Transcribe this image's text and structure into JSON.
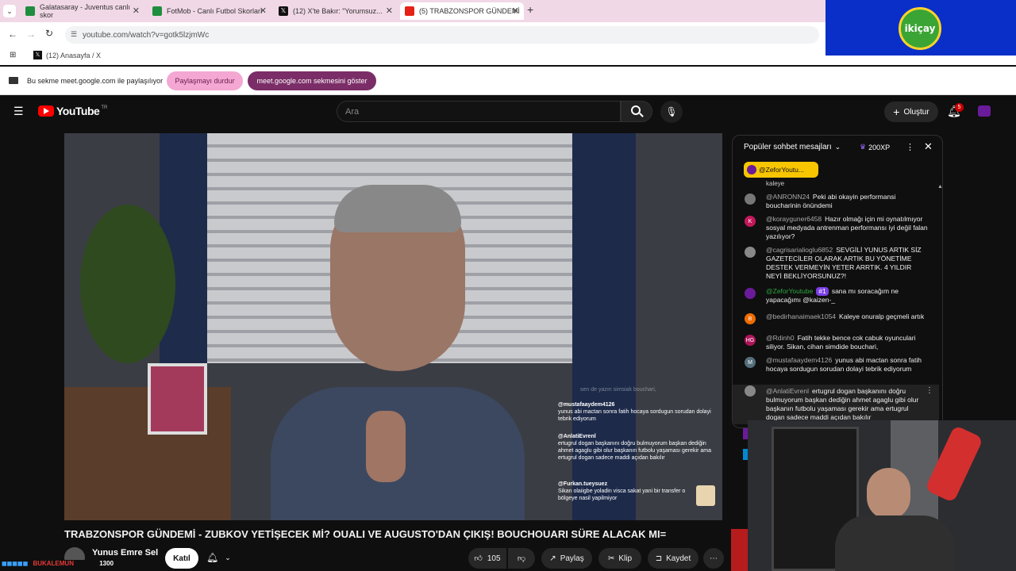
{
  "browser": {
    "tabs": [
      {
        "label": "Galatasaray - Juventus canlı skor",
        "color": "#1e8e3e"
      },
      {
        "label": "FotMob - Canlı Futbol Skorları",
        "color": "#1e8e3e"
      },
      {
        "label": "(12) X'te Bakır: \"Yorumsuz...",
        "color": "#111111"
      },
      {
        "label": "(5) TRABZONSPOR GÜNDEMİ",
        "color": "#e62117"
      }
    ],
    "url": "youtube.com/watch?v=gotk5lzjmWc",
    "bookmark": "(12) Anasayfa / X",
    "share_text": "Bu sekme meet.google.com ile paylaşılıyor",
    "stop_share": "Paylaşmayı durdur",
    "show_tab": "meet.google.com sekmesini göster"
  },
  "overlay_logo": "ikiçay",
  "youtube": {
    "logo": "YouTube",
    "region": "TR",
    "search_placeholder": "Ara",
    "create": "Oluştur",
    "notif_count": "5",
    "video_title": "TRABZONSPOR GÜNDEMİ - ZUBKOV YETİŞECEK Mİ? OUALI VE AUGUSTO'DAN ÇIKIŞ! BOUCHOUARI SÜRE ALACAK MI=",
    "channel": "Yunus Emre Sel",
    "subscribers": "BUKALEMUN",
    "subs_suffix": "1300",
    "join": "Katıl",
    "likes": "105",
    "share": "Paylaş",
    "clip": "Klip",
    "save": "Kaydet"
  },
  "chat": {
    "header": "Popüler sohbet mesajları",
    "xp": "200XP",
    "pinned": "@ZeforYoutu...",
    "fragment": "kaleye",
    "messages": [
      {
        "author": "@ANRONN24",
        "text": "Peki abi okayin performansi boucharinin önündemi",
        "initial": "",
        "color": "#777777"
      },
      {
        "author": "@korayguner6458",
        "text": "Hazır olmağı için mi oynatılmıyor sosyal medyada antrenman performansı iyi değil falan yazılıyor?",
        "initial": "K",
        "color": "#c2185b"
      },
      {
        "author": "@cagrisarialioglu6852",
        "text": "SEVGİLİ YUNUS ARTIK SİZ GAZETECİLER OLARAK ARTIK BU YÖNETİME DESTEK VERMEYİN YETER ARRTIK. 4 YILDIR NEYİ BEKLİYORSUNUZ?!",
        "initial": "",
        "color": "#888888"
      },
      {
        "author": "@ZeforYoutube",
        "badge": "#1",
        "text": "sana mı soracağım ne yapacağımı @kaizen-_",
        "initial": "",
        "color": "#6a1b9a"
      },
      {
        "author": "@bedirhanaimaek1054",
        "text": "Kaleye onuralp geçmeli artık",
        "initial": "B",
        "color": "#ef6c00"
      },
      {
        "author": "@Rdinh0",
        "text": "Fatih tekke bence cok cabuk oyunculari siliyor. Sikan, cihan simdide bouchari,",
        "initial": "HG",
        "color": "#ad1457"
      },
      {
        "author": "@mustafaaydem4126",
        "text": "yunus abi mactan sonra fatih hocaya sordugun sorudan dolayi tebrik ediyorum",
        "initial": "M",
        "color": "#546e7a"
      },
      {
        "author": "@AnlatiEvrenl",
        "text": "ertugrul dogan başkanını doğru bulmuyorum başkan dediğin ahmet agaglu gibi olur başkanın futbolu yaşaması gerekir ama ertugrul dogan sadece maddi açıdan bakılır",
        "initial": "",
        "color": "#888888"
      }
    ]
  },
  "video_overlay": {
    "faded": "sen de yazın simsiak bouchari,",
    "items": [
      {
        "author": "@mustafaaydem4126",
        "text": "yunus abi mactan sonra fatih hocaya sordugun sorudan dolayi tebrik ediyorum"
      },
      {
        "author": "@AnlatiEvrenl",
        "text": "ertugrul dogan başkanını doğru bulmuyorum başkan dediğin ahmet agaglu gibi olur başkanın futbolu yaşaması gerekir ama ertugrul dogan sadece maddi açıdan bakılır"
      },
      {
        "author": "@Furkan.tueysuez",
        "text": "Sikan olaiigbe yoladin visca sakat yani bir transfer o bölgeye nasil yapilmiyor"
      }
    ]
  }
}
